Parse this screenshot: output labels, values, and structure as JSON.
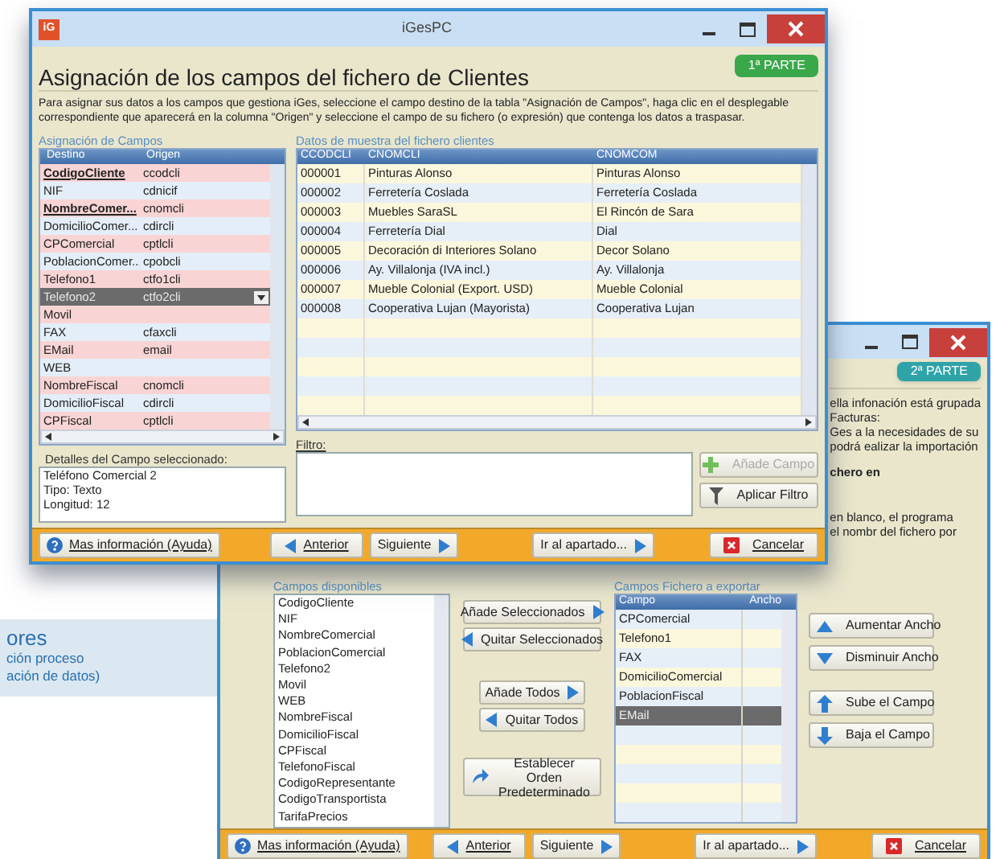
{
  "window_front": {
    "app_icon": "iG",
    "title": "iGesPC",
    "heading": "Asignación de los campos del fichero de Clientes",
    "badge": "1ª PARTE",
    "description": "Para asignar sus datos a los campos que gestiona iGes, seleccione el campo destino de la tabla \"Asignación de Campos\",  haga clic en el desplegable correspondiente que aparecerá en la columna \"Origen\" y seleccione el campo de su fichero (o expresión) que contenga los datos a traspasar.",
    "mapping": {
      "label": "Asignación de Campos",
      "columns": [
        "Destino",
        "Origen"
      ],
      "rows": [
        {
          "destino": "CodigoCliente",
          "origen": "ccodcli",
          "required": true,
          "selected": false
        },
        {
          "destino": "NIF",
          "origen": "cdnicif",
          "required": false,
          "selected": false
        },
        {
          "destino": "NombreComer...",
          "origen": "cnomcli",
          "required": true,
          "selected": false
        },
        {
          "destino": "DomicilioComer...",
          "origen": "cdircli",
          "required": false,
          "selected": false
        },
        {
          "destino": "CPComercial",
          "origen": "cptlcli",
          "required": false,
          "selected": false
        },
        {
          "destino": "PoblacionComer...",
          "origen": "cpobcli",
          "required": false,
          "selected": false
        },
        {
          "destino": "Telefono1",
          "origen": "ctfo1cli",
          "required": false,
          "selected": false
        },
        {
          "destino": "Telefono2",
          "origen": "ctfo2cli",
          "required": false,
          "selected": true
        },
        {
          "destino": "Movil",
          "required": false,
          "selected": false
        },
        {
          "destino": "FAX",
          "origen": "cfaxcli",
          "required": false,
          "selected": false
        },
        {
          "destino": "EMail",
          "origen": "email",
          "required": false,
          "selected": false
        },
        {
          "destino": "WEB",
          "required": false,
          "selected": false
        },
        {
          "destino": "NombreFiscal",
          "origen": "cnomcli",
          "required": false,
          "selected": false
        },
        {
          "destino": "DomicilioFiscal",
          "origen": "cdircli",
          "required": false,
          "selected": false
        },
        {
          "destino": "CPFiscal",
          "origen": "cptlcli",
          "required": false,
          "selected": false
        }
      ]
    },
    "details": {
      "label": "Detalles del Campo seleccionado:",
      "lines": [
        "Teléfono Comercial 2",
        "Tipo: Texto",
        "Longitud: 12"
      ]
    },
    "sample": {
      "label": "Datos de muestra del fichero clientes",
      "columns": [
        "CCODCLI",
        "CNOMCLI",
        "CNOMCOM"
      ],
      "rows": [
        [
          "000001",
          "Pinturas Alonso",
          "Pinturas Alonso"
        ],
        [
          "000002",
          "Ferretería Coslada",
          "Ferretería Coslada"
        ],
        [
          "000003",
          "Muebles SaraSL",
          "El Rincón de Sara"
        ],
        [
          "000004",
          "Ferretería Dial",
          "Dial"
        ],
        [
          "000005",
          "Decoración di Interiores Solano",
          "Decor Solano"
        ],
        [
          "000006",
          "Ay. Villalonja (IVA incl.)",
          "Ay. Villalonja"
        ],
        [
          "000007",
          "Mueble Colonial (Export. USD)",
          "Mueble Colonial"
        ],
        [
          "000008",
          "Cooperativa Lujan (Mayorista)",
          "Cooperativa Lujan"
        ]
      ]
    },
    "filter": {
      "label": "Filtro:",
      "buttons": [
        {
          "label": "Añade Campo",
          "disabled": true,
          "kind": "add"
        },
        {
          "label": "Aplicar Filtro",
          "disabled": false,
          "kind": "filter"
        }
      ]
    },
    "footer": {
      "help": "Mas información (Ayuda)",
      "previous": "Anterior",
      "next": "Siguiente",
      "goto": "Ir al apartado...",
      "cancel": "Cancelar"
    }
  },
  "window_back": {
    "badge": "2ª PARTE",
    "partial_lines": [
      {
        "text": "ella infonación está grupada",
        "bold": false
      },
      {
        "text": "Facturas:",
        "bold": false
      },
      {
        "text": "Ges a la necesidades de su",
        "bold": false
      },
      {
        "text": "podrá ealizar la importación",
        "bold": false
      },
      {
        "text": "chero en",
        "bold": true
      },
      {
        "text": "en blanco, el programa",
        "bold": false
      },
      {
        "text": "el nombr del fichero por",
        "bold": false
      }
    ],
    "available": {
      "label": "Campos disponibles",
      "items": [
        "CodigoCliente",
        "NIF",
        "NombreComercial",
        "PoblacionComercial",
        "Telefono2",
        "Movil",
        "WEB",
        "NombreFiscal",
        "DomicilioFiscal",
        "CPFiscal",
        "TelefonoFiscal",
        "CodigoRepresentante",
        "CodigoTransportista",
        "TarifaPrecios"
      ]
    },
    "middle_buttons": [
      {
        "label": "Añade Seleccionados",
        "kind": "right"
      },
      {
        "label": "Quitar Seleccionados",
        "kind": "left"
      },
      {
        "label": "Añade Todos",
        "kind": "right"
      },
      {
        "label": "Quitar Todos",
        "kind": "left"
      },
      {
        "label": "Establecer Orden Predeterminado",
        "kind": "reset"
      }
    ],
    "export": {
      "label": "Campos Fichero a exportar",
      "columns": [
        "Campo",
        "Ancho"
      ],
      "rows": [
        {
          "campo": "CPComercial",
          "selected": false
        },
        {
          "campo": "Telefono1",
          "selected": false
        },
        {
          "campo": "FAX",
          "selected": false
        },
        {
          "campo": "DomicilioComercial",
          "selected": false
        },
        {
          "campo": "PoblacionFiscal",
          "selected": false
        },
        {
          "campo": "EMail",
          "selected": true
        }
      ]
    },
    "side_buttons": [
      {
        "label": "Aumentar Ancho",
        "kind": "up"
      },
      {
        "label": "Disminuir Ancho",
        "kind": "down"
      },
      {
        "label": "Sube el Campo",
        "kind": "up_field"
      },
      {
        "label": "Baja el Campo",
        "kind": "down_field"
      }
    ],
    "footer": {
      "help": "Mas información (Ayuda)",
      "previous": "Anterior",
      "next": "Siguiente",
      "goto": "Ir al apartado...",
      "cancel": "Cancelar"
    }
  },
  "caption": {
    "title": "ores",
    "lines": [
      "ción proceso",
      "ación de datos)"
    ]
  }
}
